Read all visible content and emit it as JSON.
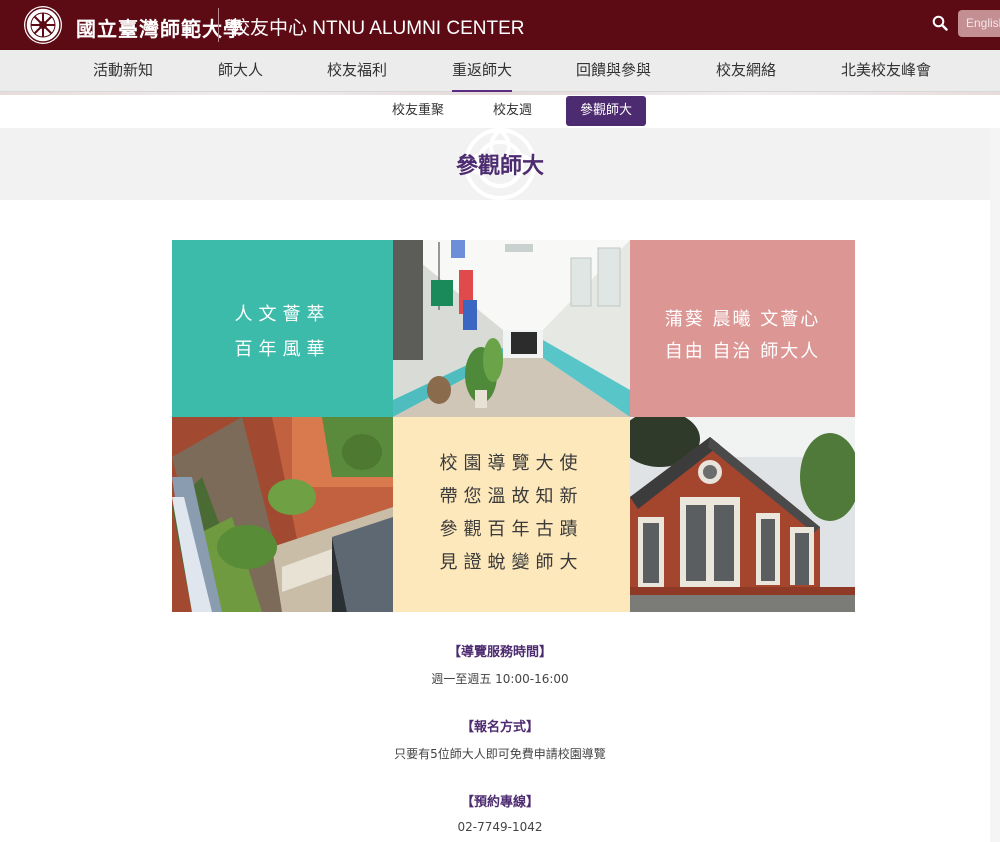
{
  "header": {
    "university_name": "國立臺灣師範大學",
    "center_title": "校友中心 NTNU ALUMNI CENTER",
    "language_button": "English"
  },
  "main_nav": [
    {
      "label": "活動新知",
      "active": false
    },
    {
      "label": "師大人",
      "active": false
    },
    {
      "label": "校友福利",
      "active": false
    },
    {
      "label": "重返師大",
      "active": true
    },
    {
      "label": "回饋與參與",
      "active": false
    },
    {
      "label": "校友網絡",
      "active": false
    },
    {
      "label": "北美校友峰會",
      "active": false
    }
  ],
  "sub_nav": [
    {
      "label": "校友重聚",
      "active": false
    },
    {
      "label": "校友週",
      "active": false
    },
    {
      "label": "參觀師大",
      "active": true
    }
  ],
  "page_title": "參觀師大",
  "collage": {
    "teal_lines": [
      "人文薈萃",
      "百年風華"
    ],
    "pink_lines": [
      "蒲葵 晨曦 文薈心",
      "自由 自治 師大人"
    ],
    "cream_lines": [
      "校園導覽大使",
      "帶您溫故知新",
      "參觀百年古蹟",
      "見證蛻變師大"
    ]
  },
  "info": [
    {
      "heading": "【導覽服務時間】",
      "value": "週一至週五 10:00-16:00"
    },
    {
      "heading": "【報名方式】",
      "value": "只要有5位師大人即可免費申請校園導覽"
    },
    {
      "heading": "【預約專線】",
      "value": "02-7749-1042"
    }
  ],
  "colors": {
    "header_bg": "#5c0a14",
    "accent_purple": "#4d2b70",
    "teal": "#3dbbaa",
    "pink": "#dc9795",
    "cream": "#fde8bc"
  }
}
